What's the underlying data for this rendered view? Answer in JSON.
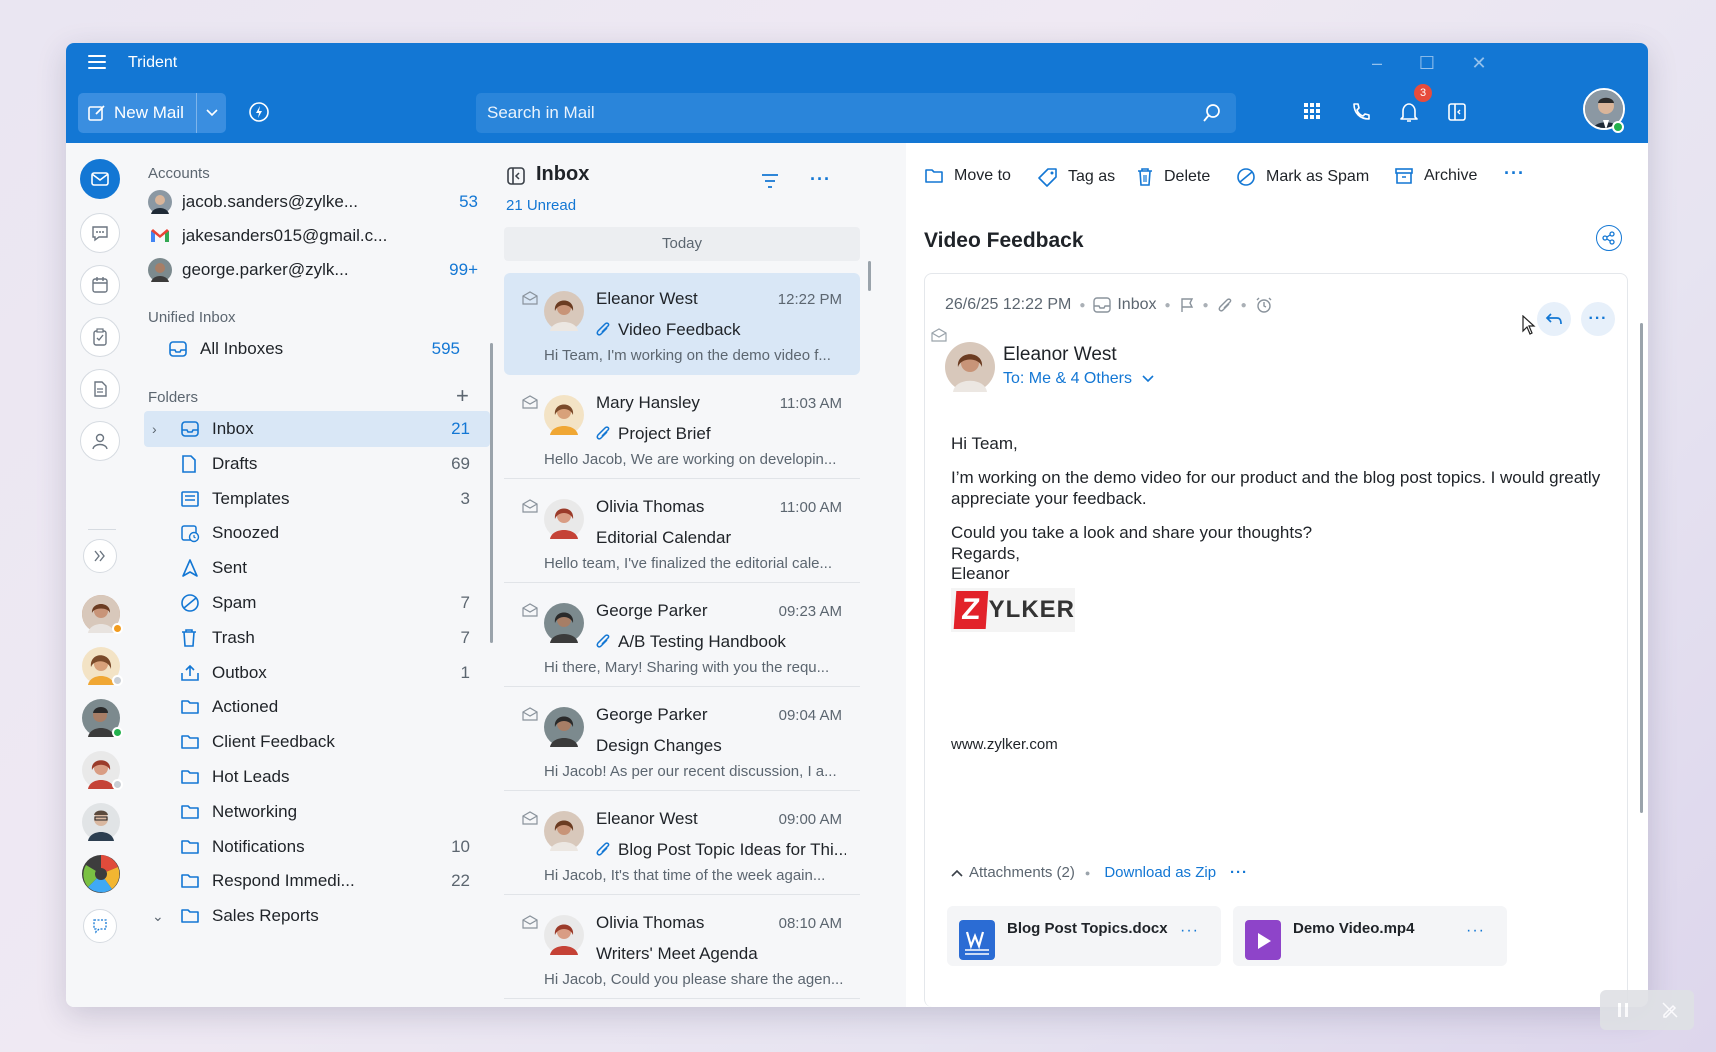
{
  "app": {
    "title": "Trident"
  },
  "toolbar": {
    "new_mail": "New Mail",
    "search_placeholder": "Search in Mail",
    "notification_count": "3"
  },
  "accounts": {
    "heading": "Accounts",
    "items": [
      {
        "email": "jacob.sanders@zylke...",
        "count": "53"
      },
      {
        "email": "jakesanders015@gmail.c...",
        "count": ""
      },
      {
        "email": "george.parker@zylk...",
        "count": "99+"
      }
    ]
  },
  "unified": {
    "heading": "Unified Inbox",
    "all_inboxes": "All Inboxes",
    "all_count": "595"
  },
  "folders": {
    "heading": "Folders",
    "items": [
      {
        "name": "Inbox",
        "count": "21"
      },
      {
        "name": "Drafts",
        "count": "69"
      },
      {
        "name": "Templates",
        "count": "3"
      },
      {
        "name": "Snoozed",
        "count": ""
      },
      {
        "name": "Sent",
        "count": ""
      },
      {
        "name": "Spam",
        "count": "7"
      },
      {
        "name": "Trash",
        "count": "7"
      },
      {
        "name": "Outbox",
        "count": "1"
      },
      {
        "name": "Actioned",
        "count": ""
      },
      {
        "name": "Client Feedback",
        "count": ""
      },
      {
        "name": "Hot Leads",
        "count": ""
      },
      {
        "name": "Networking",
        "count": ""
      },
      {
        "name": "Notifications",
        "count": "10"
      },
      {
        "name": "Respond Immedi...",
        "count": "22"
      },
      {
        "name": "Sales Reports",
        "count": ""
      }
    ]
  },
  "list": {
    "title": "Inbox",
    "unread": "21 Unread",
    "group": "Today",
    "mails": [
      {
        "from": "Eleanor West",
        "time": "12:22 PM",
        "subject": "Video Feedback",
        "preview": "Hi Team, I'm working on the demo video f...",
        "attach": true
      },
      {
        "from": "Mary Hansley",
        "time": "11:03 AM",
        "subject": "Project Brief",
        "preview": "Hello Jacob, We are working on developin...",
        "attach": true
      },
      {
        "from": "Olivia Thomas",
        "time": "11:00 AM",
        "subject": "Editorial Calendar",
        "preview": "Hello team, I've finalized the editorial cale...",
        "attach": false
      },
      {
        "from": "George Parker",
        "time": "09:23 AM",
        "subject": "A/B Testing Handbook",
        "preview": "Hi there, Mary! Sharing with you the requ...",
        "attach": true
      },
      {
        "from": "George Parker",
        "time": "09:04 AM",
        "subject": "Design Changes",
        "preview": "Hi Jacob! As per our recent discussion, I a...",
        "attach": false
      },
      {
        "from": "Eleanor West",
        "time": "09:00 AM",
        "subject": "Blog Post Topic Ideas for Thi...",
        "preview": "Hi Jacob, It's that time of the week again...",
        "attach": true
      },
      {
        "from": "Olivia Thomas",
        "time": "08:10 AM",
        "subject": "Writers' Meet Agenda",
        "preview": "Hi Jacob, Could you please share the agen...",
        "attach": false
      }
    ]
  },
  "reader": {
    "actions": {
      "move": "Move to",
      "tag": "Tag as",
      "delete": "Delete",
      "spam": "Mark as Spam",
      "archive": "Archive"
    },
    "subject": "Video Feedback",
    "date": "26/6/25 12:22 PM",
    "folder": "Inbox",
    "sender": "Eleanor West",
    "to": "To: Me & 4 Others",
    "body": {
      "greeting": "Hi Team,",
      "p1": "I’m working on the demo video for our product and the blog post topics. I would greatly appreciate your feedback.",
      "p2_l1": "Could you take a look and share your thoughts?",
      "p2_l2": "Regards,",
      "p2_l3": "Eleanor"
    },
    "logo_z": "Z",
    "logo_rest": "YLKER",
    "website": "www.zylker.com",
    "attachments_label": "Attachments (2)",
    "download_zip": "Download as Zip",
    "attachments": [
      {
        "name": "Blog Post Topics.docx"
      },
      {
        "name": "Demo Video.mp4"
      }
    ]
  },
  "colors": {
    "accent": "#1377d4",
    "header": "#1377d4",
    "selected": "#d9e7f6",
    "badge": "#e74c3c"
  }
}
